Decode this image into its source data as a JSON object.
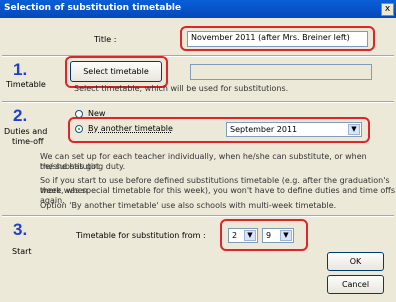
{
  "window": {
    "title": "Selection of substitution timetable",
    "close_glyph": "x"
  },
  "title_row": {
    "label": "Title :",
    "value": "November 2011 (after Mrs. Breiner left)"
  },
  "section1": {
    "number": "1.",
    "side_label": "Timetable",
    "select_button": "Select timetable",
    "selected_value": "",
    "hint": "Select timetable, which will be used for substitutions."
  },
  "section2": {
    "number": "2.",
    "side_label_line1": "Duties and",
    "side_label_line2": "time-off",
    "radio_new": "New",
    "radio_other": "By another timetable",
    "other_timetable_value": "September 2011",
    "para1_line1": "We can set up for each teacher individually, when he/she can substitute, or when he/she has got",
    "para1_line2": "the substituting duty.",
    "para2_line1": "So if you start to use before defined substitutions timetable (e.g. after the graduation's week, when",
    "para2_line2": "there was special timetable for this week), you won't have to define duties and time offs again.",
    "para3": "Option 'By another timetable' use also schools with multi-week timetable."
  },
  "section3": {
    "number": "3.",
    "side_label": "Start",
    "from_label": "Timetable for substitution from :",
    "month_value": "2",
    "day_value": "9"
  },
  "buttons": {
    "ok": "OK",
    "cancel": "Cancel"
  },
  "colors": {
    "titlebar": "#0a5fd8",
    "highlight": "#e0242a",
    "step_number": "#1f3fcf"
  }
}
